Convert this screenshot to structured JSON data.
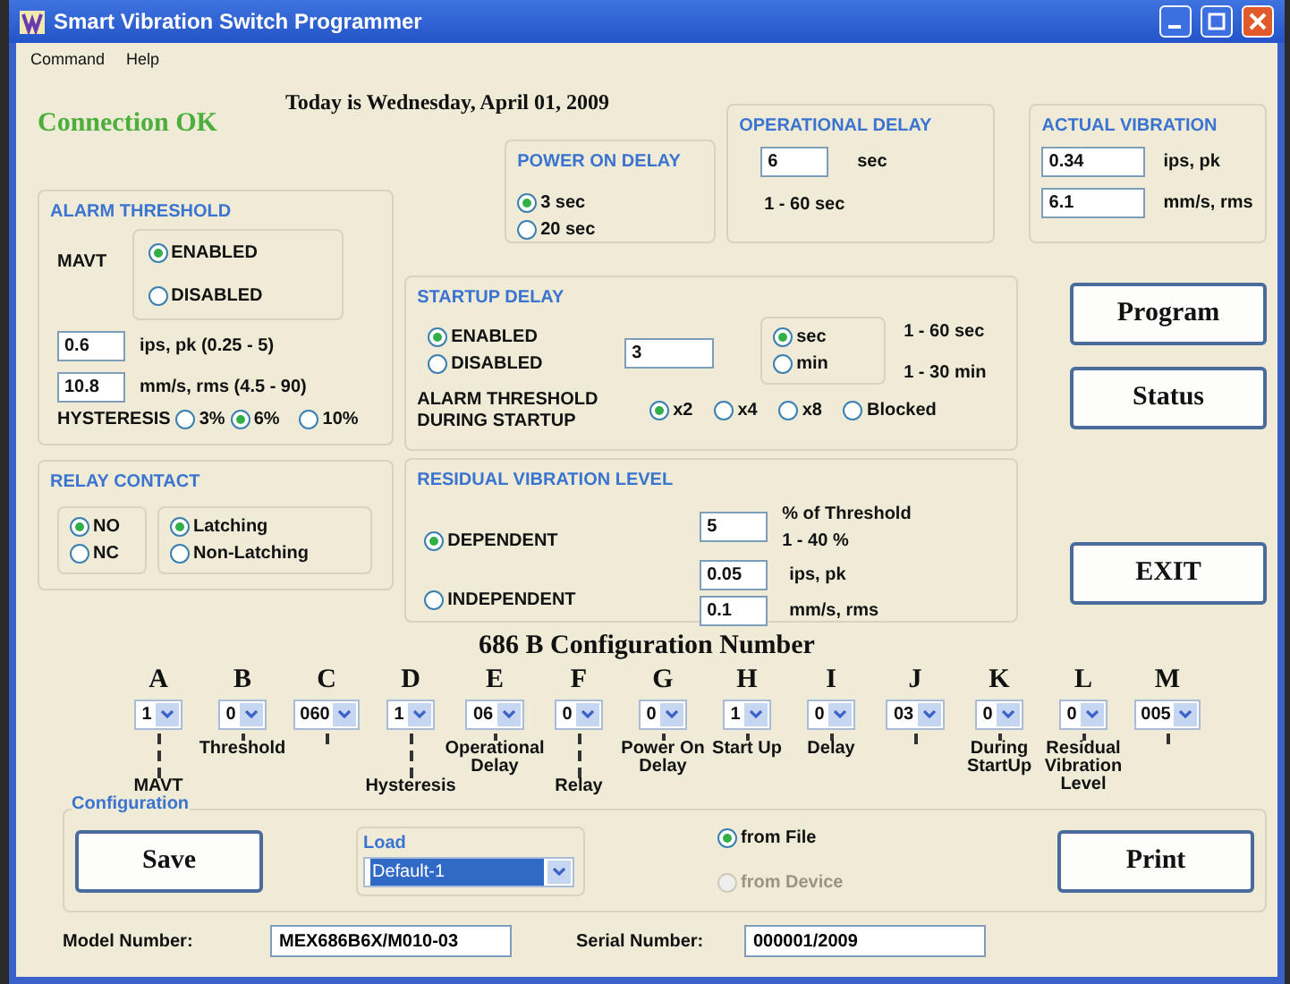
{
  "window": {
    "title": "Smart Vibration Switch Programmer"
  },
  "menu": [
    "Command",
    "Help"
  ],
  "connection_status": "Connection OK",
  "date_text": "Today is  Wednesday, April 01, 2009",
  "alarm_threshold": {
    "title": "ALARM THRESHOLD",
    "mavt_label": "MAVT",
    "mavt_options": [
      {
        "label": "ENABLED",
        "selected": true
      },
      {
        "label": "DISABLED",
        "selected": false
      }
    ],
    "ips_value": "0.6",
    "ips_unit": "ips, pk (0.25 - 5)",
    "mm_value": "10.8",
    "mm_unit": "mm/s, rms (4.5 - 90)",
    "hysteresis_label": "HYSTERESIS",
    "hysteresis_options": [
      {
        "label": "3%",
        "selected": false
      },
      {
        "label": "6%",
        "selected": true
      },
      {
        "label": "10%",
        "selected": false
      }
    ]
  },
  "relay_contact": {
    "title": "RELAY CONTACT",
    "contact_options": [
      {
        "label": "NO",
        "selected": true
      },
      {
        "label": "NC",
        "selected": false
      }
    ],
    "latch_options": [
      {
        "label": "Latching",
        "selected": true
      },
      {
        "label": "Non-Latching",
        "selected": false
      }
    ]
  },
  "power_on_delay": {
    "title": "POWER ON DELAY",
    "options": [
      {
        "label": "3 sec",
        "selected": true
      },
      {
        "label": "20 sec",
        "selected": false
      }
    ]
  },
  "operational_delay": {
    "title": "OPERATIONAL DELAY",
    "value": "6",
    "unit": "sec",
    "range": "1 - 60 sec"
  },
  "actual_vibration": {
    "title": "ACTUAL VIBRATION",
    "ips_value": "0.34",
    "ips_unit": "ips, pk",
    "mm_value": "6.1",
    "mm_unit": "mm/s, rms"
  },
  "startup_delay": {
    "title": "STARTUP DELAY",
    "enable_options": [
      {
        "label": "ENABLED",
        "selected": true
      },
      {
        "label": "DISABLED",
        "selected": false
      }
    ],
    "value": "3",
    "unit_options": [
      {
        "label": "sec",
        "selected": true
      },
      {
        "label": "min",
        "selected": false
      }
    ],
    "ranges": [
      "1 - 60 sec",
      "1 - 30 min"
    ],
    "threshold_label": "ALARM THRESHOLD DURING STARTUP",
    "threshold_options": [
      {
        "label": "x2",
        "selected": true
      },
      {
        "label": "x4",
        "selected": false
      },
      {
        "label": "x8",
        "selected": false
      },
      {
        "label": "Blocked",
        "selected": false
      }
    ]
  },
  "residual_vibration": {
    "title": "RESIDUAL VIBRATION LEVEL",
    "options": [
      {
        "label": "DEPENDENT",
        "selected": true
      },
      {
        "label": "INDEPENDENT",
        "selected": false
      }
    ],
    "percent_value": "5",
    "percent_unit": "% of Threshold",
    "percent_range": "1 - 40 %",
    "ips_value": "0.05",
    "ips_unit": "ips, pk",
    "mm_value": "0.1",
    "mm_unit": "mm/s, rms"
  },
  "buttons": [
    "Program",
    "Status",
    "EXIT"
  ],
  "configuration_number": {
    "title": "686 B Configuration Number",
    "fields": [
      {
        "letter": "A",
        "value": "1",
        "label": "MAVT"
      },
      {
        "letter": "B",
        "value": "0",
        "label": "Threshold"
      },
      {
        "letter": "C",
        "value": "060"
      },
      {
        "letter": "D",
        "value": "1",
        "label": "Hysteresis"
      },
      {
        "letter": "E",
        "value": "06",
        "label": "Operational Delay"
      },
      {
        "letter": "F",
        "value": "0",
        "label": "Relay"
      },
      {
        "letter": "G",
        "value": "0",
        "label": "Power On Delay"
      },
      {
        "letter": "H",
        "value": "1",
        "label": "Start Up"
      },
      {
        "letter": "I",
        "value": "0",
        "label": "Delay"
      },
      {
        "letter": "J",
        "value": "03"
      },
      {
        "letter": "K",
        "value": "0",
        "label": "During StartUp"
      },
      {
        "letter": "L",
        "value": "0",
        "label": "Residual Vibration Level"
      },
      {
        "letter": "M",
        "value": "005"
      }
    ]
  },
  "configuration": {
    "title": "Configuration",
    "save_button": "Save",
    "load_title": "Load",
    "load_value": "Default-1",
    "sources": [
      {
        "label": "from File",
        "selected": true,
        "disabled": false
      },
      {
        "label": "from Device",
        "selected": false,
        "disabled": true
      }
    ],
    "print_button": "Print"
  },
  "model_number": {
    "label": "Model Number:",
    "value": "MEX686B6X/M010-03"
  },
  "serial_number": {
    "label": "Serial Number:",
    "value": "000001/2009"
  }
}
